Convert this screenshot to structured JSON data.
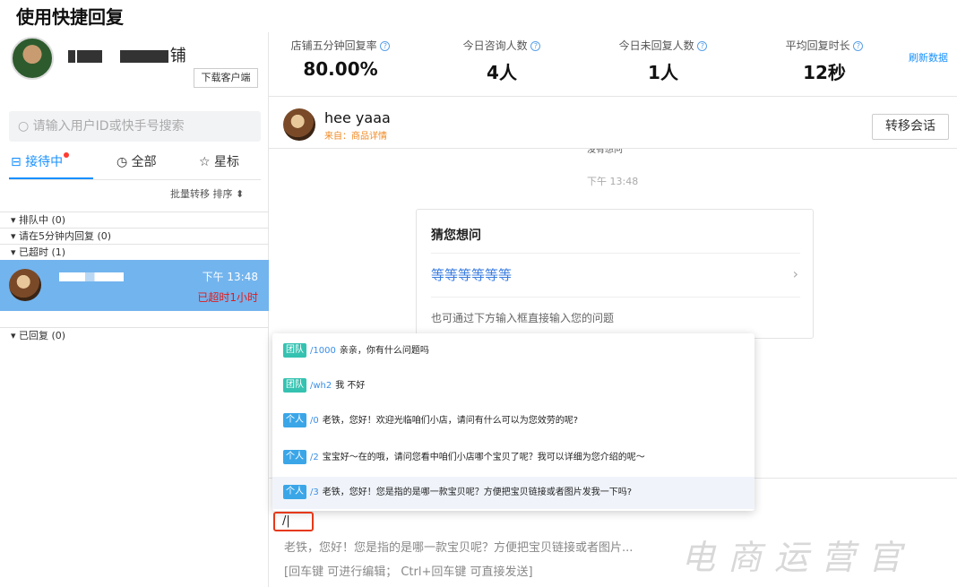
{
  "heading": "使用快捷回复",
  "profile": {
    "shop_suffix": "铺",
    "download_btn": "下载客户端"
  },
  "search": {
    "placeholder": "请输入用户ID或快手号搜索"
  },
  "tabs": [
    {
      "label": "接待中"
    },
    {
      "label": "全部"
    },
    {
      "label": "星标"
    }
  ],
  "toolbar": {
    "batch": "批量转移",
    "sort": "排序"
  },
  "sections": {
    "queue": "▾ 排队中 (0)",
    "reply5": "▾ 请在5分钟内回复 (0)",
    "overtime": "▾ 已超时 (1)",
    "replied": "▾ 已回复 (0)"
  },
  "customer": {
    "time": "下午 13:48",
    "status": "已超时1小时"
  },
  "stats": [
    {
      "label": "店铺五分钟回复率",
      "value": "80.00%"
    },
    {
      "label": "今日咨询人数",
      "value": "4人"
    },
    {
      "label": "今日未回复人数",
      "value": "1人"
    },
    {
      "label": "平均回复时长",
      "value": "12秒"
    }
  ],
  "refresh": "刷新数据",
  "chat": {
    "name": "hee yaaa",
    "source": "来自：商品详情",
    "transfer": "转移会话",
    "clipped": "没有想问",
    "timestamp": "下午 13:48"
  },
  "card": {
    "title": "猜您想问",
    "link": "等等等等等等",
    "hint": "也可通过下方输入框直接输入您的问题"
  },
  "quick_replies": [
    {
      "tag": "团队",
      "cmd": "/1000",
      "text": "亲亲，你有什么问题吗"
    },
    {
      "tag": "团队",
      "cmd": "/wh2",
      "text": "我 不好"
    },
    {
      "tag": "个人",
      "cmd": "/0",
      "text": "老铁，您好！欢迎光临咱们小店，请问有什么可以为您效劳的呢?"
    },
    {
      "tag": "个人",
      "cmd": "/2",
      "text": "宝宝好～在的哦，请问您看中咱们小店哪个宝贝了呢？我可以详细为您介绍的呢～"
    },
    {
      "tag": "个人",
      "cmd": "/3",
      "text": "老铁，您好！您是指的是哪一款宝贝呢？方便把宝贝链接或者图片发我一下吗?"
    }
  ],
  "input": {
    "value": "/|",
    "preview": "老铁，您好！您是指的是哪一款宝贝呢？方便把宝贝链接或者图片...",
    "hint": "[回车键 可进行编辑；  Ctrl+回车键 可直接发送]"
  },
  "watermark": "电商运营官"
}
